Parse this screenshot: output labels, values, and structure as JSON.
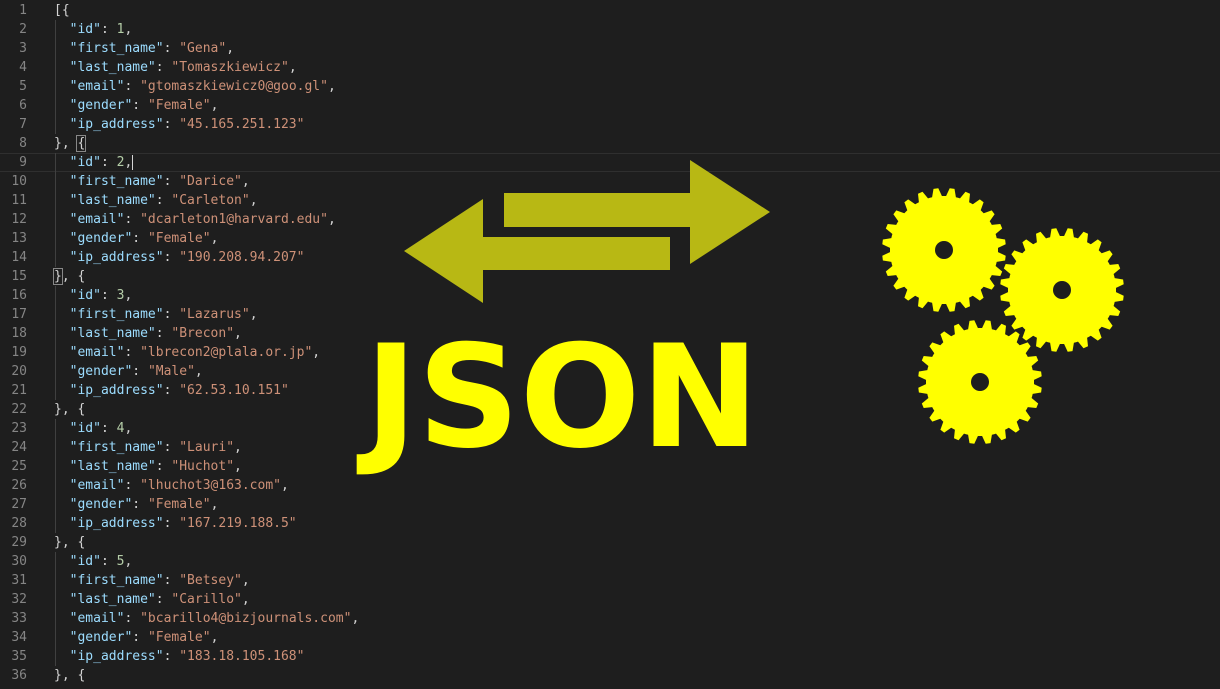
{
  "editor": {
    "lines": [
      {
        "n": "1",
        "tokens": [
          {
            "t": "punc",
            "v": "[{"
          }
        ]
      },
      {
        "n": "2",
        "tokens": [
          {
            "t": "ws",
            "v": "  "
          },
          {
            "t": "key",
            "v": "\"id\""
          },
          {
            "t": "punc",
            "v": ": "
          },
          {
            "t": "num",
            "v": "1"
          },
          {
            "t": "punc",
            "v": ","
          }
        ]
      },
      {
        "n": "3",
        "tokens": [
          {
            "t": "ws",
            "v": "  "
          },
          {
            "t": "key",
            "v": "\"first_name\""
          },
          {
            "t": "punc",
            "v": ": "
          },
          {
            "t": "str",
            "v": "\"Gena\""
          },
          {
            "t": "punc",
            "v": ","
          }
        ]
      },
      {
        "n": "4",
        "tokens": [
          {
            "t": "ws",
            "v": "  "
          },
          {
            "t": "key",
            "v": "\"last_name\""
          },
          {
            "t": "punc",
            "v": ": "
          },
          {
            "t": "str",
            "v": "\"Tomaszkiewicz\""
          },
          {
            "t": "punc",
            "v": ","
          }
        ]
      },
      {
        "n": "5",
        "tokens": [
          {
            "t": "ws",
            "v": "  "
          },
          {
            "t": "key",
            "v": "\"email\""
          },
          {
            "t": "punc",
            "v": ": "
          },
          {
            "t": "str",
            "v": "\"gtomaszkiewicz0@goo.gl\""
          },
          {
            "t": "punc",
            "v": ","
          }
        ]
      },
      {
        "n": "6",
        "tokens": [
          {
            "t": "ws",
            "v": "  "
          },
          {
            "t": "key",
            "v": "\"gender\""
          },
          {
            "t": "punc",
            "v": ": "
          },
          {
            "t": "str",
            "v": "\"Female\""
          },
          {
            "t": "punc",
            "v": ","
          }
        ]
      },
      {
        "n": "7",
        "tokens": [
          {
            "t": "ws",
            "v": "  "
          },
          {
            "t": "key",
            "v": "\"ip_address\""
          },
          {
            "t": "punc",
            "v": ": "
          },
          {
            "t": "str",
            "v": "\"45.165.251.123\""
          }
        ]
      },
      {
        "n": "8",
        "tokens": [
          {
            "t": "punc",
            "v": "}, "
          },
          {
            "t": "match",
            "v": "{"
          }
        ]
      },
      {
        "n": "9",
        "current": true,
        "tokens": [
          {
            "t": "ws",
            "v": "  "
          },
          {
            "t": "key",
            "v": "\"id\""
          },
          {
            "t": "punc",
            "v": ": "
          },
          {
            "t": "num",
            "v": "2"
          },
          {
            "t": "punc",
            "v": ","
          },
          {
            "t": "cursor",
            "v": ""
          }
        ]
      },
      {
        "n": "10",
        "tokens": [
          {
            "t": "ws",
            "v": "  "
          },
          {
            "t": "key",
            "v": "\"first_name\""
          },
          {
            "t": "punc",
            "v": ": "
          },
          {
            "t": "str",
            "v": "\"Darice\""
          },
          {
            "t": "punc",
            "v": ","
          }
        ]
      },
      {
        "n": "11",
        "tokens": [
          {
            "t": "ws",
            "v": "  "
          },
          {
            "t": "key",
            "v": "\"last_name\""
          },
          {
            "t": "punc",
            "v": ": "
          },
          {
            "t": "str",
            "v": "\"Carleton\""
          },
          {
            "t": "punc",
            "v": ","
          }
        ]
      },
      {
        "n": "12",
        "tokens": [
          {
            "t": "ws",
            "v": "  "
          },
          {
            "t": "key",
            "v": "\"email\""
          },
          {
            "t": "punc",
            "v": ": "
          },
          {
            "t": "str",
            "v": "\"dcarleton1@harvard.edu\""
          },
          {
            "t": "punc",
            "v": ","
          }
        ]
      },
      {
        "n": "13",
        "tokens": [
          {
            "t": "ws",
            "v": "  "
          },
          {
            "t": "key",
            "v": "\"gender\""
          },
          {
            "t": "punc",
            "v": ": "
          },
          {
            "t": "str",
            "v": "\"Female\""
          },
          {
            "t": "punc",
            "v": ","
          }
        ]
      },
      {
        "n": "14",
        "tokens": [
          {
            "t": "ws",
            "v": "  "
          },
          {
            "t": "key",
            "v": "\"ip_address\""
          },
          {
            "t": "punc",
            "v": ": "
          },
          {
            "t": "str",
            "v": "\"190.208.94.207\""
          }
        ]
      },
      {
        "n": "15",
        "tokens": [
          {
            "t": "match",
            "v": "}"
          },
          {
            "t": "punc",
            "v": ", {"
          }
        ]
      },
      {
        "n": "16",
        "tokens": [
          {
            "t": "ws",
            "v": "  "
          },
          {
            "t": "key",
            "v": "\"id\""
          },
          {
            "t": "punc",
            "v": ": "
          },
          {
            "t": "num",
            "v": "3"
          },
          {
            "t": "punc",
            "v": ","
          }
        ]
      },
      {
        "n": "17",
        "tokens": [
          {
            "t": "ws",
            "v": "  "
          },
          {
            "t": "key",
            "v": "\"first_name\""
          },
          {
            "t": "punc",
            "v": ": "
          },
          {
            "t": "str",
            "v": "\"Lazarus\""
          },
          {
            "t": "punc",
            "v": ","
          }
        ]
      },
      {
        "n": "18",
        "tokens": [
          {
            "t": "ws",
            "v": "  "
          },
          {
            "t": "key",
            "v": "\"last_name\""
          },
          {
            "t": "punc",
            "v": ": "
          },
          {
            "t": "str",
            "v": "\"Brecon\""
          },
          {
            "t": "punc",
            "v": ","
          }
        ]
      },
      {
        "n": "19",
        "tokens": [
          {
            "t": "ws",
            "v": "  "
          },
          {
            "t": "key",
            "v": "\"email\""
          },
          {
            "t": "punc",
            "v": ": "
          },
          {
            "t": "str",
            "v": "\"lbrecon2@plala.or.jp\""
          },
          {
            "t": "punc",
            "v": ","
          }
        ]
      },
      {
        "n": "20",
        "tokens": [
          {
            "t": "ws",
            "v": "  "
          },
          {
            "t": "key",
            "v": "\"gender\""
          },
          {
            "t": "punc",
            "v": ": "
          },
          {
            "t": "str",
            "v": "\"Male\""
          },
          {
            "t": "punc",
            "v": ","
          }
        ]
      },
      {
        "n": "21",
        "tokens": [
          {
            "t": "ws",
            "v": "  "
          },
          {
            "t": "key",
            "v": "\"ip_address\""
          },
          {
            "t": "punc",
            "v": ": "
          },
          {
            "t": "str",
            "v": "\"62.53.10.151\""
          }
        ]
      },
      {
        "n": "22",
        "tokens": [
          {
            "t": "punc",
            "v": "}, {"
          }
        ]
      },
      {
        "n": "23",
        "tokens": [
          {
            "t": "ws",
            "v": "  "
          },
          {
            "t": "key",
            "v": "\"id\""
          },
          {
            "t": "punc",
            "v": ": "
          },
          {
            "t": "num",
            "v": "4"
          },
          {
            "t": "punc",
            "v": ","
          }
        ]
      },
      {
        "n": "24",
        "tokens": [
          {
            "t": "ws",
            "v": "  "
          },
          {
            "t": "key",
            "v": "\"first_name\""
          },
          {
            "t": "punc",
            "v": ": "
          },
          {
            "t": "str",
            "v": "\"Lauri\""
          },
          {
            "t": "punc",
            "v": ","
          }
        ]
      },
      {
        "n": "25",
        "tokens": [
          {
            "t": "ws",
            "v": "  "
          },
          {
            "t": "key",
            "v": "\"last_name\""
          },
          {
            "t": "punc",
            "v": ": "
          },
          {
            "t": "str",
            "v": "\"Huchot\""
          },
          {
            "t": "punc",
            "v": ","
          }
        ]
      },
      {
        "n": "26",
        "tokens": [
          {
            "t": "ws",
            "v": "  "
          },
          {
            "t": "key",
            "v": "\"email\""
          },
          {
            "t": "punc",
            "v": ": "
          },
          {
            "t": "str",
            "v": "\"lhuchot3@163.com\""
          },
          {
            "t": "punc",
            "v": ","
          }
        ]
      },
      {
        "n": "27",
        "tokens": [
          {
            "t": "ws",
            "v": "  "
          },
          {
            "t": "key",
            "v": "\"gender\""
          },
          {
            "t": "punc",
            "v": ": "
          },
          {
            "t": "str",
            "v": "\"Female\""
          },
          {
            "t": "punc",
            "v": ","
          }
        ]
      },
      {
        "n": "28",
        "tokens": [
          {
            "t": "ws",
            "v": "  "
          },
          {
            "t": "key",
            "v": "\"ip_address\""
          },
          {
            "t": "punc",
            "v": ": "
          },
          {
            "t": "str",
            "v": "\"167.219.188.5\""
          }
        ]
      },
      {
        "n": "29",
        "tokens": [
          {
            "t": "punc",
            "v": "}, {"
          }
        ]
      },
      {
        "n": "30",
        "tokens": [
          {
            "t": "ws",
            "v": "  "
          },
          {
            "t": "key",
            "v": "\"id\""
          },
          {
            "t": "punc",
            "v": ": "
          },
          {
            "t": "num",
            "v": "5"
          },
          {
            "t": "punc",
            "v": ","
          }
        ]
      },
      {
        "n": "31",
        "tokens": [
          {
            "t": "ws",
            "v": "  "
          },
          {
            "t": "key",
            "v": "\"first_name\""
          },
          {
            "t": "punc",
            "v": ": "
          },
          {
            "t": "str",
            "v": "\"Betsey\""
          },
          {
            "t": "punc",
            "v": ","
          }
        ]
      },
      {
        "n": "32",
        "tokens": [
          {
            "t": "ws",
            "v": "  "
          },
          {
            "t": "key",
            "v": "\"last_name\""
          },
          {
            "t": "punc",
            "v": ": "
          },
          {
            "t": "str",
            "v": "\"Carillo\""
          },
          {
            "t": "punc",
            "v": ","
          }
        ]
      },
      {
        "n": "33",
        "tokens": [
          {
            "t": "ws",
            "v": "  "
          },
          {
            "t": "key",
            "v": "\"email\""
          },
          {
            "t": "punc",
            "v": ": "
          },
          {
            "t": "str",
            "v": "\"bcarillo4@bizjournals.com\""
          },
          {
            "t": "punc",
            "v": ","
          }
        ]
      },
      {
        "n": "34",
        "tokens": [
          {
            "t": "ws",
            "v": "  "
          },
          {
            "t": "key",
            "v": "\"gender\""
          },
          {
            "t": "punc",
            "v": ": "
          },
          {
            "t": "str",
            "v": "\"Female\""
          },
          {
            "t": "punc",
            "v": ","
          }
        ]
      },
      {
        "n": "35",
        "tokens": [
          {
            "t": "ws",
            "v": "  "
          },
          {
            "t": "key",
            "v": "\"ip_address\""
          },
          {
            "t": "punc",
            "v": ": "
          },
          {
            "t": "str",
            "v": "\"183.18.105.168\""
          }
        ]
      },
      {
        "n": "36",
        "tokens": [
          {
            "t": "punc",
            "v": "}, {"
          }
        ]
      }
    ]
  },
  "graphic": {
    "title": "JSON",
    "title_color": "#ffff00",
    "arrow_color": "#b8b814",
    "gear_color": "#ffff00",
    "icons": [
      "swap-arrows-icon",
      "gear-icon",
      "gear-icon",
      "gear-icon"
    ]
  },
  "colors": {
    "background": "#1e1e1e",
    "line_number": "#858585",
    "key": "#9cdcfe",
    "string": "#ce9178",
    "number": "#b5cea8",
    "punctuation": "#d4d4d4"
  }
}
